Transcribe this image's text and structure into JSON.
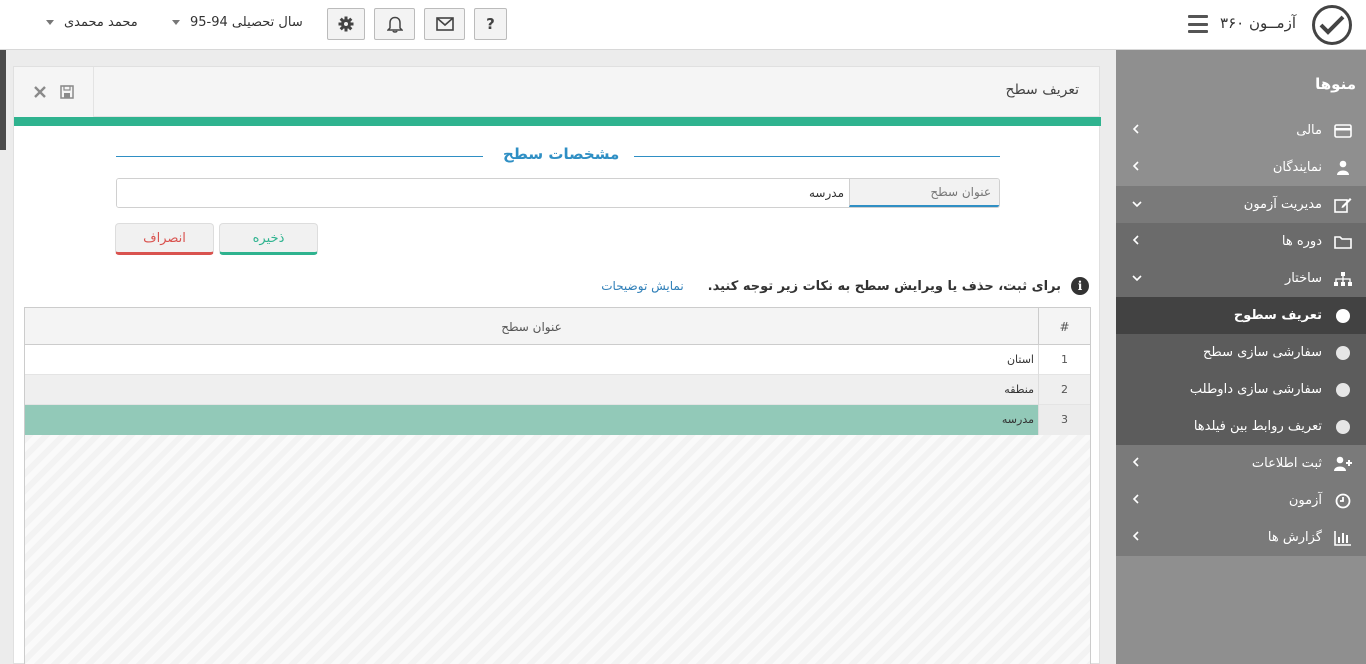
{
  "header": {
    "app_title": "آزمــون ۳۶۰",
    "help_label": "?",
    "academic_year": "سال تحصیلی 94-95",
    "user_name": "محمد محمدی"
  },
  "sidebar": {
    "heading": "منوها",
    "items": [
      {
        "label": "مالی",
        "icon": "credit-card-icon"
      },
      {
        "label": "نمایندگان",
        "icon": "agent-icon"
      },
      {
        "label": "مدیریت آزمون",
        "icon": "edit-icon"
      },
      {
        "label": "دوره ها",
        "icon": "folder-icon"
      },
      {
        "label": "ساختار",
        "icon": "sitemap-icon"
      },
      {
        "label": "تعریف سطوح",
        "icon": "circle-icon"
      },
      {
        "label": "سفارشی سازی سطح",
        "icon": "circle-icon"
      },
      {
        "label": "سفارشی سازی داوطلب",
        "icon": "circle-icon"
      },
      {
        "label": "تعریف روابط بین فیلدها",
        "icon": "circle-icon"
      },
      {
        "label": "ثبت اطلاعات",
        "icon": "user-plus-icon"
      },
      {
        "label": "آزمون",
        "icon": "clock-icon"
      },
      {
        "label": "گزارش ها",
        "icon": "bar-chart-icon"
      }
    ]
  },
  "panel": {
    "title": "تعریف سطح",
    "section_title": "مشخصات سطح",
    "field_label": "عنوان سطح",
    "field_value": "مدرسه",
    "save_label": "ذخیره",
    "cancel_label": "انصراف",
    "notice": "برای ثبت، حذف یا ویرایش سطح به نکات زیر توجه کنید.",
    "notice_link": "نمایش توضیحات"
  },
  "grid": {
    "headers": {
      "number": "#",
      "title": "عنوان سطح"
    },
    "rows": [
      {
        "num": "1",
        "title": "استان"
      },
      {
        "num": "2",
        "title": "منطقه"
      },
      {
        "num": "3",
        "title": "مدرسه"
      }
    ]
  },
  "colors": {
    "accent_green": "#2fb38f",
    "accent_blue": "#2f8fc4",
    "danger": "#d9534f",
    "selected_row": "#92c9b8",
    "sidebar": "#8f8f8f"
  }
}
